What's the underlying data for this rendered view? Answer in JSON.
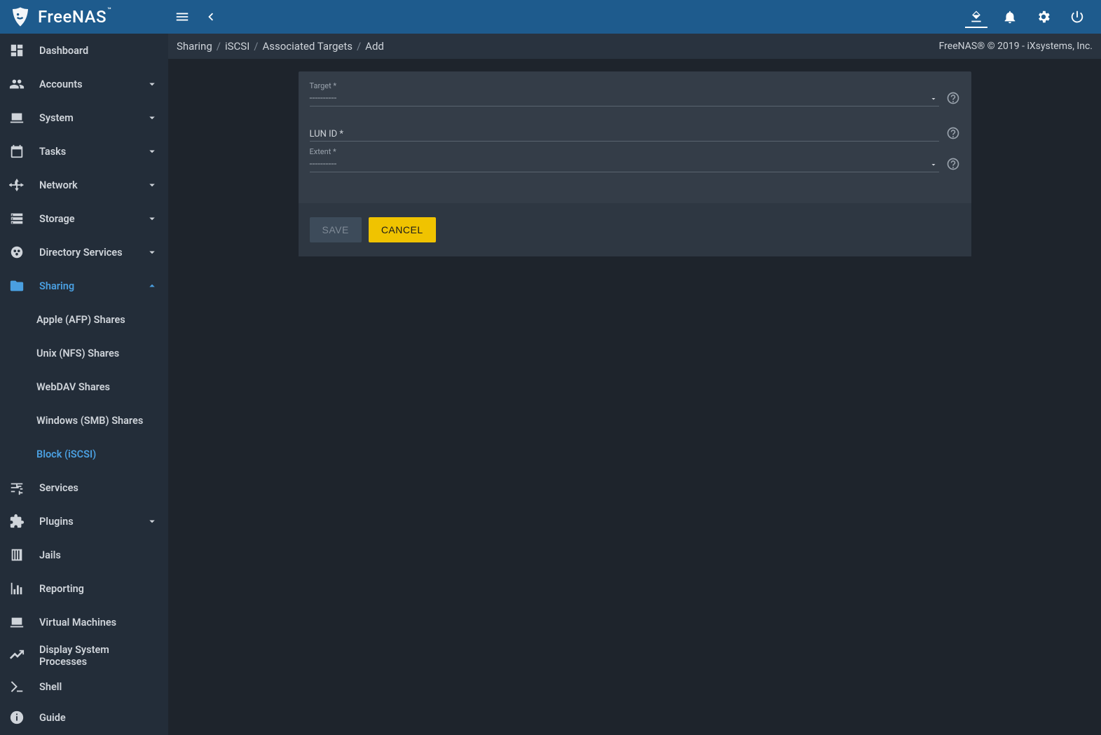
{
  "brand": {
    "name": "FreeNAS",
    "tm": "™"
  },
  "breadcrumb": {
    "a": "Sharing",
    "b": "iSCSI",
    "c": "Associated Targets",
    "d": "Add",
    "sep": "/"
  },
  "copyright": "FreeNAS® © 2019 - iXsystems, Inc.",
  "nav": {
    "dashboard": "Dashboard",
    "accounts": "Accounts",
    "system": "System",
    "tasks": "Tasks",
    "network": "Network",
    "storage": "Storage",
    "directory": "Directory Services",
    "sharing": "Sharing",
    "services": "Services",
    "plugins": "Plugins",
    "jails": "Jails",
    "reporting": "Reporting",
    "vms": "Virtual Machines",
    "dsp": "Display System Processes",
    "shell": "Shell",
    "guide": "Guide"
  },
  "sharing_sub": {
    "afp": "Apple (AFP) Shares",
    "nfs": "Unix (NFS) Shares",
    "webdav": "WebDAV Shares",
    "smb": "Windows (SMB) Shares",
    "iscsi": "Block (iSCSI)"
  },
  "form": {
    "target_label": "Target *",
    "target_value": "----------",
    "lunid_label": "LUN ID *",
    "lunid_value": "",
    "extent_label": "Extent *",
    "extent_value": "----------"
  },
  "buttons": {
    "save": "SAVE",
    "cancel": "CANCEL"
  }
}
